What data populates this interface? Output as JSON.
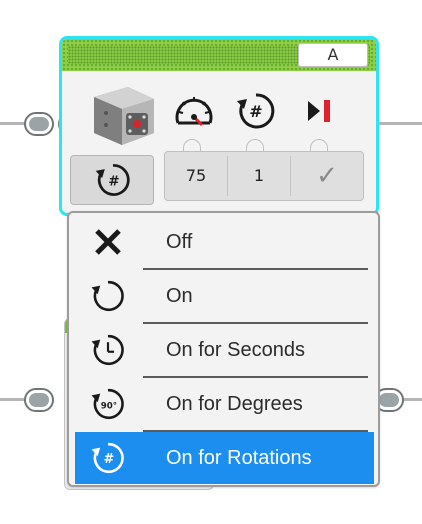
{
  "block": {
    "port": "A",
    "params": {
      "power": "75",
      "rotations": "1",
      "brake": "✓"
    }
  },
  "menu": {
    "items": [
      {
        "label": "Off",
        "icon": "x-icon",
        "selected": false
      },
      {
        "label": "On",
        "icon": "rotate-icon",
        "selected": false
      },
      {
        "label": "On for Seconds",
        "icon": "seconds-icon",
        "selected": false
      },
      {
        "label": "On for Degrees",
        "icon": "degrees-icon",
        "selected": false
      },
      {
        "label": "On for Rotations",
        "icon": "rotations-icon",
        "selected": true
      }
    ],
    "degrees_glyph": "90°",
    "rotations_glyph": "#"
  },
  "colors": {
    "highlight": "#1b8ef0",
    "block_border": "#2ee4ee",
    "header_green": "#8ed146",
    "accent_red": "#e0202a"
  }
}
